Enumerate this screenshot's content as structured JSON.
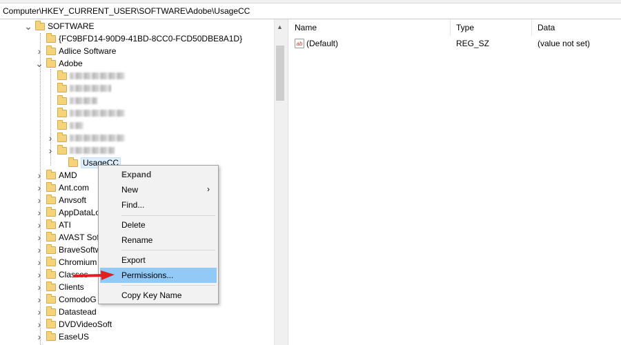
{
  "address_path": "Computer\\HKEY_CURRENT_USER\\SOFTWARE\\Adobe\\UsageCC",
  "tree": {
    "software_label": "SOFTWARE",
    "guid_key": "{FC9BFD14-90D9-41BD-8CC0-FCD50DBE8A1D}",
    "adlice_label": "Adlice Software",
    "adobe_label": "Adobe",
    "usagecc_label": "UsageCC",
    "keys_after": [
      "AMD",
      "Ant.com",
      "Anvsoft",
      "AppDataLo",
      "ATI",
      "AVAST Sof",
      "BraveSoftw",
      "Chromium",
      "Classes",
      "Clients",
      "ComodoG",
      "Datastead",
      "DVDVideoSoft",
      "EaseUS"
    ]
  },
  "list": {
    "columns": [
      "Name",
      "Type",
      "Data"
    ],
    "rows": [
      {
        "name": "(Default)",
        "type": "REG_SZ",
        "data": "(value not set)"
      }
    ]
  },
  "context_menu": {
    "expand": "Expand",
    "new": "New",
    "find": "Find...",
    "delete": "Delete",
    "rename": "Rename",
    "export": "Export",
    "permissions": "Permissions...",
    "copy_key_name": "Copy Key Name",
    "highlighted": "Permissions..."
  },
  "colors": {
    "menu_highlight": "#91c9f7",
    "folder": "#f5d37b",
    "annotation_arrow": "#e02020"
  },
  "icons": {
    "expanded": "chevron-down-icon",
    "collapsed": "chevron-right-icon",
    "folder": "folder-icon",
    "string_value": "ab-string-icon",
    "submenu": "chevron-right-icon"
  }
}
